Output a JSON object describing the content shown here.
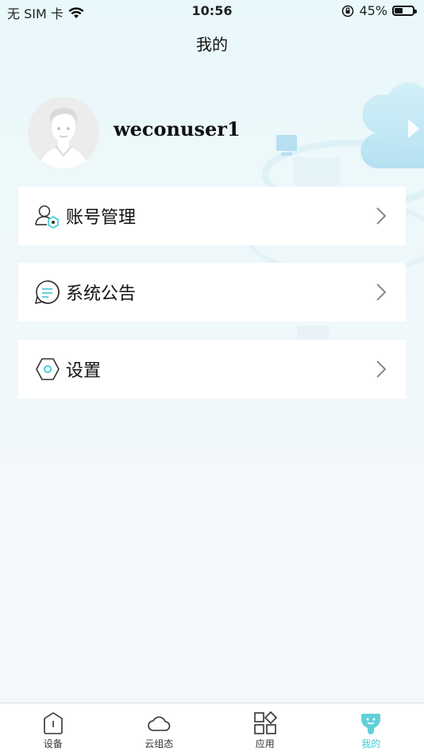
{
  "status_bar": {
    "carrier": "无 SIM 卡",
    "time": "10:56",
    "battery_percent": "45%",
    "battery_level": 0.45
  },
  "header": {
    "title": "我的"
  },
  "profile": {
    "username": "weconuser1"
  },
  "menu": [
    {
      "label": "账号管理",
      "icon": "account-icon"
    },
    {
      "label": "系统公告",
      "icon": "announcement-icon"
    },
    {
      "label": "设置",
      "icon": "settings-icon"
    }
  ],
  "tabs": [
    {
      "label": "设备",
      "icon": "device-icon"
    },
    {
      "label": "云组态",
      "icon": "cloud-icon"
    },
    {
      "label": "应用",
      "icon": "apps-icon"
    },
    {
      "label": "我的",
      "icon": "profile-icon",
      "active": true
    }
  ],
  "colors": {
    "accent": "#3ec8d2",
    "background": "#eef8fa"
  }
}
